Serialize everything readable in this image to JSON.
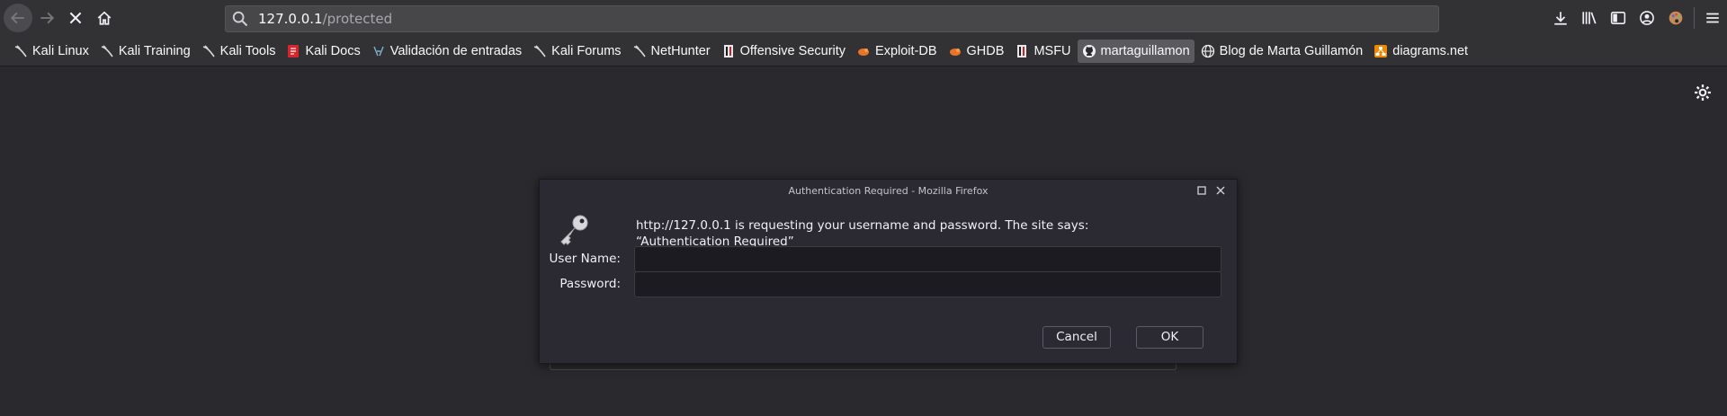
{
  "toolbar": {
    "url_host": "127.0.0.1",
    "url_path": "/protected"
  },
  "bookmarks": [
    {
      "label": "Kali Linux",
      "icon": "kali-dragon-icon"
    },
    {
      "label": "Kali Training",
      "icon": "kali-dragon-icon"
    },
    {
      "label": "Kali Tools",
      "icon": "kali-dragon-icon"
    },
    {
      "label": "Kali Docs",
      "icon": "kali-docs-icon"
    },
    {
      "label": "Validación de entradas",
      "icon": "validation-icon"
    },
    {
      "label": "Kali Forums",
      "icon": "kali-dragon-icon"
    },
    {
      "label": "NetHunter",
      "icon": "kali-dragon-icon"
    },
    {
      "label": "Offensive Security",
      "icon": "offsec-icon"
    },
    {
      "label": "Exploit-DB",
      "icon": "exploit-db-icon"
    },
    {
      "label": "GHDB",
      "icon": "exploit-db-icon"
    },
    {
      "label": "MSFU",
      "icon": "offsec-icon"
    },
    {
      "label": "martaguillamon",
      "icon": "github-icon"
    },
    {
      "label": "Blog de Marta Guillamón",
      "icon": "globe-icon"
    },
    {
      "label": "diagrams.net",
      "icon": "diagrams-icon"
    }
  ],
  "dialog": {
    "title": "Authentication Required - Mozilla Firefox",
    "message": "http://127.0.0.1 is requesting your username and password. The site says: “Authentication Required”",
    "username_label": "User Name:",
    "password_label": "Password:",
    "username_value": "",
    "password_value": "",
    "cancel_label": "Cancel",
    "ok_label": "OK"
  },
  "colors": {
    "toolbar_bg": "#323234",
    "content_bg": "#2a2a2e",
    "dialog_bg": "#2b2a33",
    "active_bookmark_bg": "#5b5b5f"
  }
}
